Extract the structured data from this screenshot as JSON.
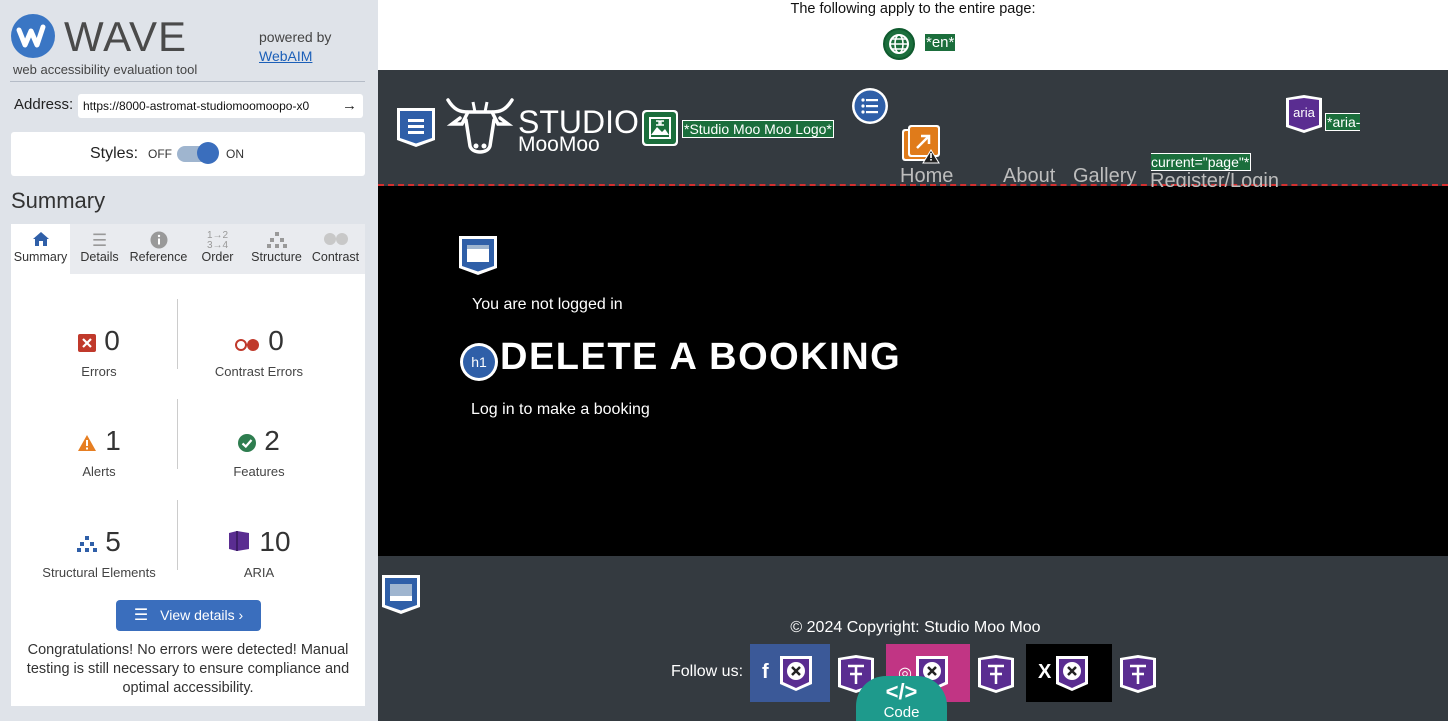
{
  "wave": {
    "logo_text": "WAVE",
    "subtitle": "web accessibility evaluation tool",
    "powered_by": "powered by",
    "webaim_link": "WebAIM",
    "address_label": "Address:",
    "address_value": "https://8000-astromat-studiomoomoopo-x0",
    "styles_label": "Styles:",
    "styles_off": "OFF",
    "styles_on": "ON",
    "summary_heading": "Summary",
    "tabs": [
      {
        "label": "Summary",
        "icon": "home-icon"
      },
      {
        "label": "Details",
        "icon": "list-icon"
      },
      {
        "label": "Reference",
        "icon": "info-icon"
      },
      {
        "label": "Order",
        "icon": "order-icon"
      },
      {
        "label": "Structure",
        "icon": "structure-icon"
      },
      {
        "label": "Contrast",
        "icon": "contrast-icon"
      }
    ],
    "stats": {
      "errors": {
        "count": "0",
        "label": "Errors"
      },
      "contrast_errors": {
        "count": "0",
        "label": "Contrast Errors"
      },
      "alerts": {
        "count": "1",
        "label": "Alerts"
      },
      "features": {
        "count": "2",
        "label": "Features"
      },
      "structural": {
        "count": "5",
        "label": "Structural Elements"
      },
      "aria": {
        "count": "10",
        "label": "ARIA"
      }
    },
    "view_details": "View details ›",
    "congrats": "Congratulations! No errors were detected! Manual testing is still necessary to ensure compliance and optimal accessibility."
  },
  "page": {
    "notice": "The following apply to the entire page:",
    "lang_label": "*en*",
    "logo_studio": "STUDIO",
    "logo_moomoo": "MooMoo",
    "logo_alt_label": "*Studio Moo Moo Logo*",
    "nav": [
      "Home",
      "About",
      "Gallery",
      "Register/Login"
    ],
    "aria_icon_text": "aria",
    "aria_current_label": "*aria-current=\"page\"*",
    "login_status": "You are not logged in",
    "h1_icon_text": "h1",
    "title": "DELETE A BOOKING",
    "login_prompt": "Log in to make a booking",
    "copyright": "© 2024 Copyright: Studio Moo Moo",
    "follow_label": "Follow us:",
    "code_label": "Code"
  },
  "colors": {
    "wave_blue": "#3a6ebd",
    "feature_green": "#1b6e3c",
    "header_bg": "#343a40",
    "aria_purple": "#5a2d91",
    "error_red": "#c0392b",
    "alert_orange": "#e67e22",
    "code_teal": "#1e9a8c"
  }
}
